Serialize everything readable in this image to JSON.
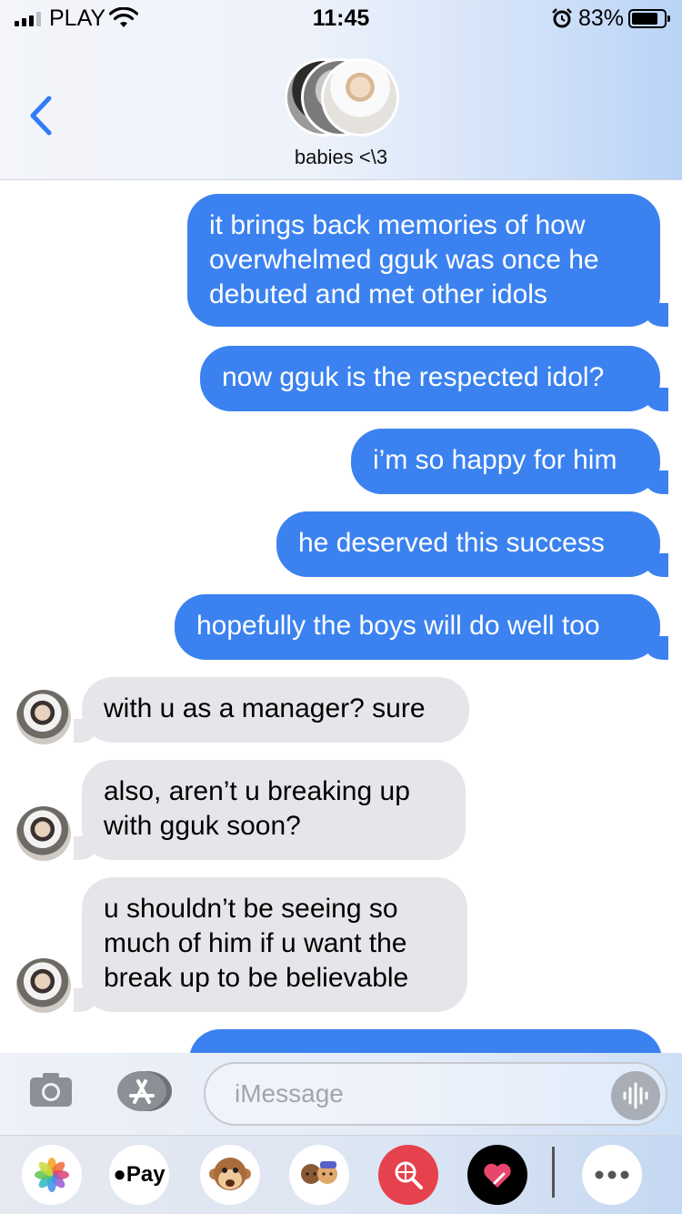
{
  "status_bar": {
    "carrier": "PLAY",
    "time": "11:45",
    "battery_percent": "83%",
    "signal_bars": 3,
    "battery_level": 0.83
  },
  "header": {
    "group_name": "babies <\\3",
    "back_icon": "chevron-left-icon"
  },
  "messages": [
    {
      "direction": "outgoing",
      "text": "it brings back memories of how overwhelmed gguk was once he debuted and met other idols"
    },
    {
      "direction": "outgoing",
      "text": "now gguk is the respected idol?"
    },
    {
      "direction": "outgoing",
      "text": "i’m so happy for him"
    },
    {
      "direction": "outgoing",
      "text": "he deserved this success"
    },
    {
      "direction": "outgoing",
      "text": "hopefully the boys will do well too"
    },
    {
      "direction": "incoming",
      "text": "with u as a manager? sure"
    },
    {
      "direction": "incoming",
      "text": "also, aren’t u breaking up with gguk soon?"
    },
    {
      "direction": "incoming",
      "text": "u shouldn’t be seeing so much of him if u want the break up to be believable"
    }
  ],
  "compose": {
    "placeholder": "iMessage",
    "camera_icon": "camera-icon",
    "apps_icon": "app-store-icon",
    "audio_icon": "audio-waveform-icon"
  },
  "app_drawer": {
    "apple_pay_label": "Pay",
    "apps": [
      "photos-icon",
      "apple-pay-icon",
      "monkey-animoji-icon",
      "memoji-stickers-icon",
      "web-search-icon",
      "digital-touch-icon",
      "more-icon"
    ]
  },
  "colors": {
    "outgoing_bubble": "#3b82f0",
    "incoming_bubble": "#e6e6ea",
    "accent": "#2f7cf6"
  }
}
